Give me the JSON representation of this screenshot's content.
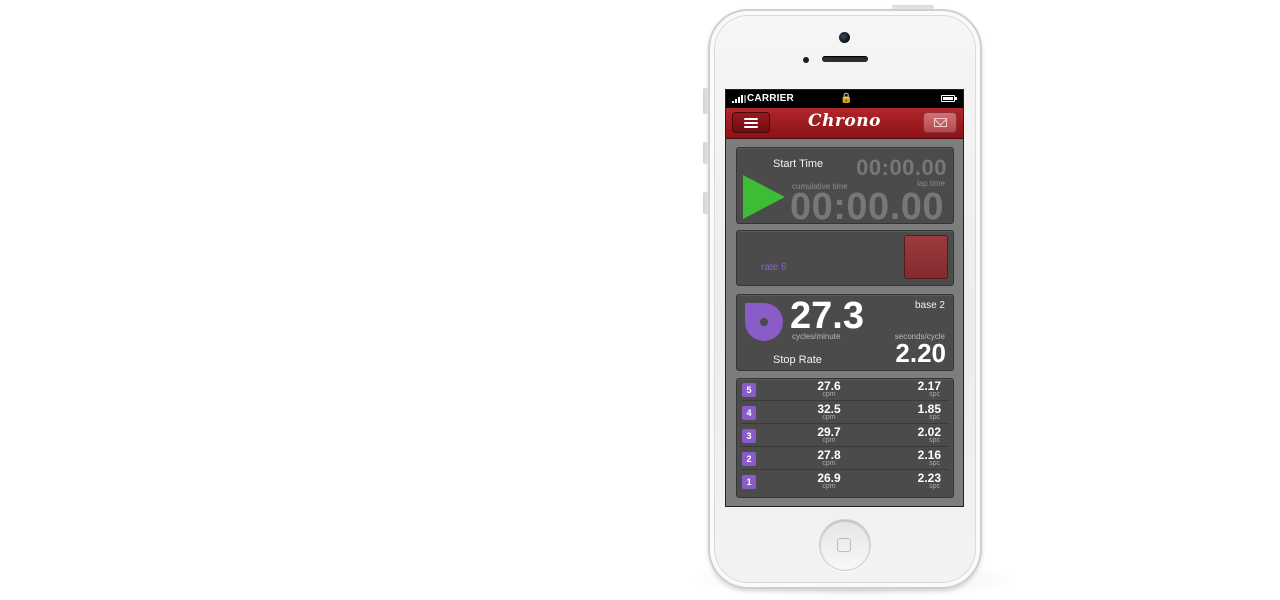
{
  "status_bar": {
    "carrier": "CARRIER",
    "lock_icon": "lock-icon",
    "battery_icon": "battery-icon",
    "signal_icon": "signal-bars-icon"
  },
  "navbar": {
    "title": "Chrono",
    "menu_icon": "hamburger-menu-icon",
    "mail_icon": "envelope-icon",
    "color": "#a01c21"
  },
  "timer_panel": {
    "start_label": "Start Time",
    "lap_time_value": "00:00.00",
    "lap_time_label": "lap time",
    "cumulative_label": "cumulative time",
    "cumulative_value": "00:00.00",
    "play_icon": "play-icon",
    "play_color": "#3dbd35"
  },
  "rate_panel": {
    "rate_label": "rate 6",
    "stop_button_color": "#8f3236"
  },
  "stats_panel": {
    "rate_value": "27.3",
    "rate_units": "cycles/minute",
    "base_label": "base 2",
    "spc_label": "seconds/cycle",
    "spc_value": "2.20",
    "stop_label": "Stop Rate",
    "pie_icon": "progress-pie-icon",
    "accent": "#8a5cc7"
  },
  "laps": [
    {
      "num": "5",
      "cpm": "27.6",
      "cpm_unit": "cpm",
      "spc": "2.17",
      "spc_unit": "spc"
    },
    {
      "num": "4",
      "cpm": "32.5",
      "cpm_unit": "cpm",
      "spc": "1.85",
      "spc_unit": "spc"
    },
    {
      "num": "3",
      "cpm": "29.7",
      "cpm_unit": "cpm",
      "spc": "2.02",
      "spc_unit": "spc"
    },
    {
      "num": "2",
      "cpm": "27.8",
      "cpm_unit": "cpm",
      "spc": "2.16",
      "spc_unit": "spc"
    },
    {
      "num": "1",
      "cpm": "26.9",
      "cpm_unit": "cpm",
      "spc": "2.23",
      "spc_unit": "spc"
    }
  ]
}
